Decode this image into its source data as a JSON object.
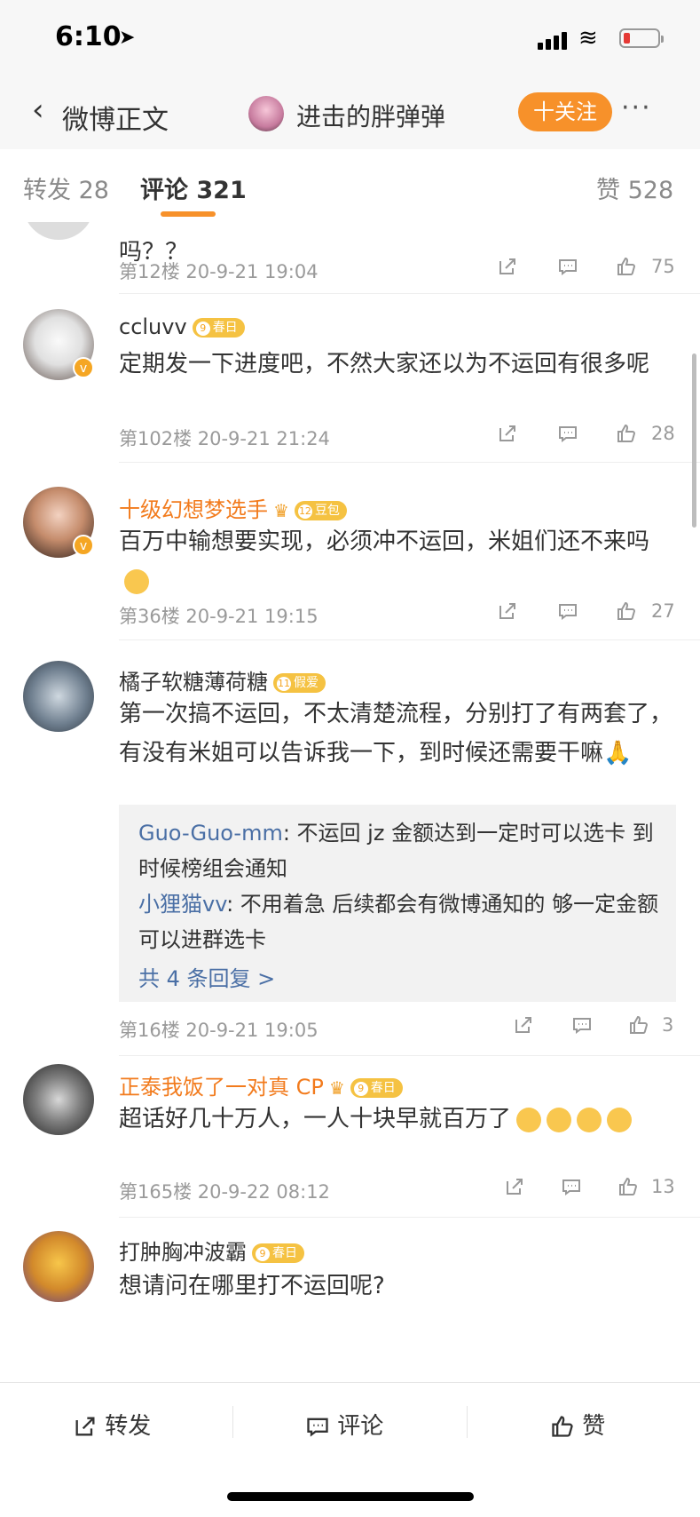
{
  "status_bar": {
    "time": "6:10",
    "location_icon": "location-arrow-icon"
  },
  "nav": {
    "back_label": "微博正文",
    "username": "进击的胖弹弹",
    "follow_label": "十关注",
    "more_label": "···"
  },
  "tabs": {
    "repost": "转发 28",
    "comment": "评论 321",
    "like": "赞 528"
  },
  "comments": [
    {
      "text": "吗？？",
      "meta": "第12楼 20-9-21 19:04",
      "likes": "75"
    },
    {
      "username": "ccluvv",
      "badge_level": "9",
      "badge_text": "春日",
      "text": "定期发一下进度吧，不然大家还以为不运回有很多呢",
      "meta": "第102楼 20-9-21 21:24",
      "likes": "28"
    },
    {
      "username": "十级幻想梦选手",
      "badge_level": "12",
      "badge_text": "豆包",
      "text": "百万中输想要实现，必须冲不运回，米姐们还不来吗",
      "meta": "第36楼 20-9-21 19:15",
      "likes": "27"
    },
    {
      "username": "橘子软糖薄荷糖",
      "badge_level": "11",
      "badge_text": "假爱",
      "text": "第一次搞不运回，不太清楚流程，分别打了有两套了，有没有米姐可以告诉我一下，到时候还需要干嘛",
      "meta": "第16楼 20-9-21 19:05",
      "likes": "3",
      "replies": [
        {
          "name": "Guo-Guo-mm",
          "text": ": 不运回 jz 金额达到一定时可以选卡 到时候榜组会通知"
        },
        {
          "name": "小狸猫vv",
          "text": ": 不用着急 后续都会有微博通知的 够一定金额可以进群选卡"
        }
      ],
      "more_replies": "共 4 条回复 >"
    },
    {
      "username": "正泰我饭了一对真 CP",
      "badge_level": "9",
      "badge_text": "春日",
      "text": "超话好几十万人，一人十块早就百万了",
      "meta": "第165楼 20-9-22 08:12",
      "likes": "13"
    },
    {
      "username": "打肿胸冲波霸",
      "badge_level": "9",
      "badge_text": "春日",
      "text": "想请问在哪里打不运回呢?"
    }
  ],
  "bottom": {
    "repost": "转发",
    "comment": "评论",
    "like": "赞"
  },
  "colors": {
    "accent": "#f7912a",
    "link": "#4a6fa5"
  }
}
